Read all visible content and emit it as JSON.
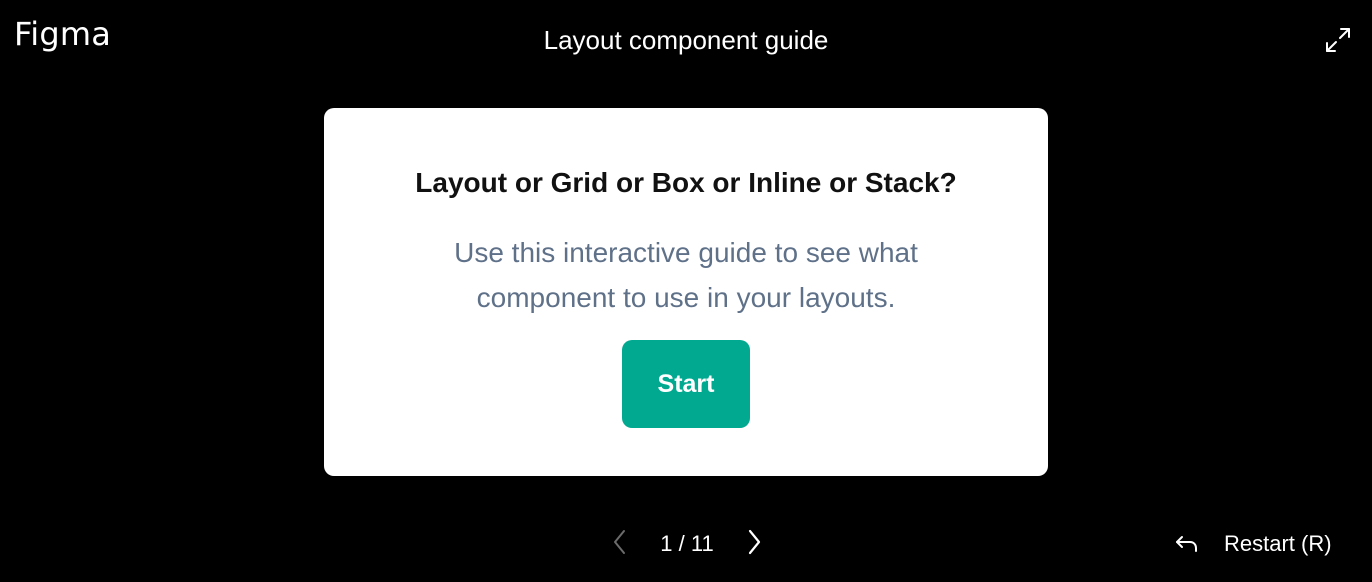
{
  "header": {
    "logo": "Figma",
    "title": "Layout component guide",
    "expand_icon": "expand-icon"
  },
  "card": {
    "heading": "Layout or Grid or Box or Inline or Stack?",
    "description": "Use this interactive guide to see what component to use in your layouts.",
    "start_label": "Start"
  },
  "footer": {
    "prev_icon": "chevron-left-icon",
    "page_indicator": "1 / 11",
    "next_icon": "chevron-right-icon",
    "restart_icon": "undo-arrow-icon",
    "restart_label": "Restart (R)"
  },
  "colors": {
    "background": "#000000",
    "card": "#ffffff",
    "accent": "#00a990",
    "description_text": "#5f7189",
    "disabled_icon": "#6b6b6b"
  }
}
